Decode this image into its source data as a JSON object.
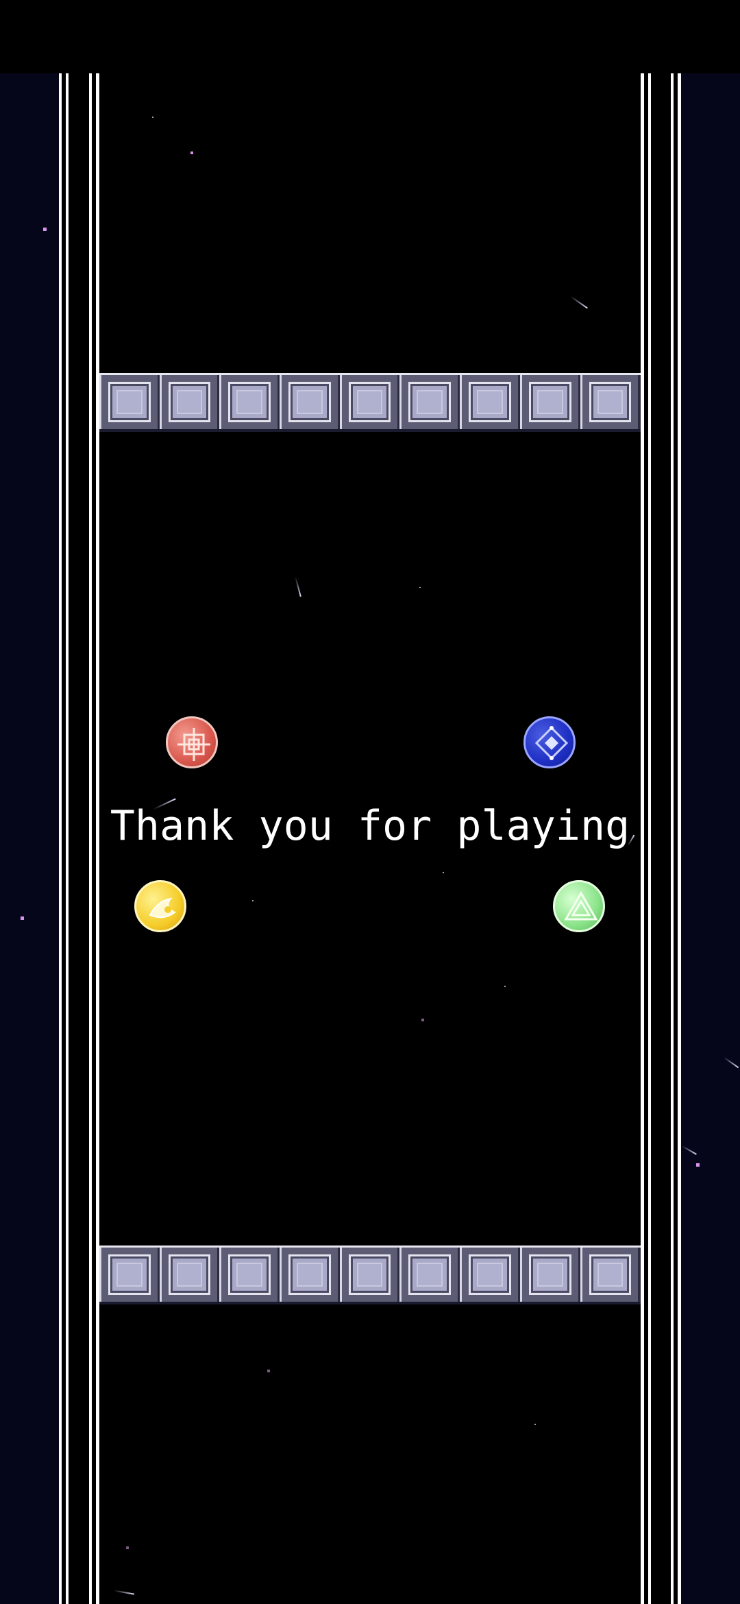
{
  "scene": {
    "message": "Thank you for playing"
  },
  "icons": {
    "red_orb": "target-crosshair-icon",
    "blue_orb": "diamond-gem-icon",
    "yellow_orb": "swirl-moon-icon",
    "green_orb": "triangle-icon"
  },
  "colors": {
    "background": "#000000",
    "side_space": "#06061a",
    "rail": "#ffffff",
    "brick_face": "#a9a9c8",
    "brick_frame": "#5c5c74",
    "message_text": "#ffffff",
    "red_orb": "#d9574c",
    "blue_orb": "#1f2fc4",
    "yellow_orb": "#f5cd2a",
    "green_orb": "#8be38a",
    "star": "#d892e8"
  }
}
